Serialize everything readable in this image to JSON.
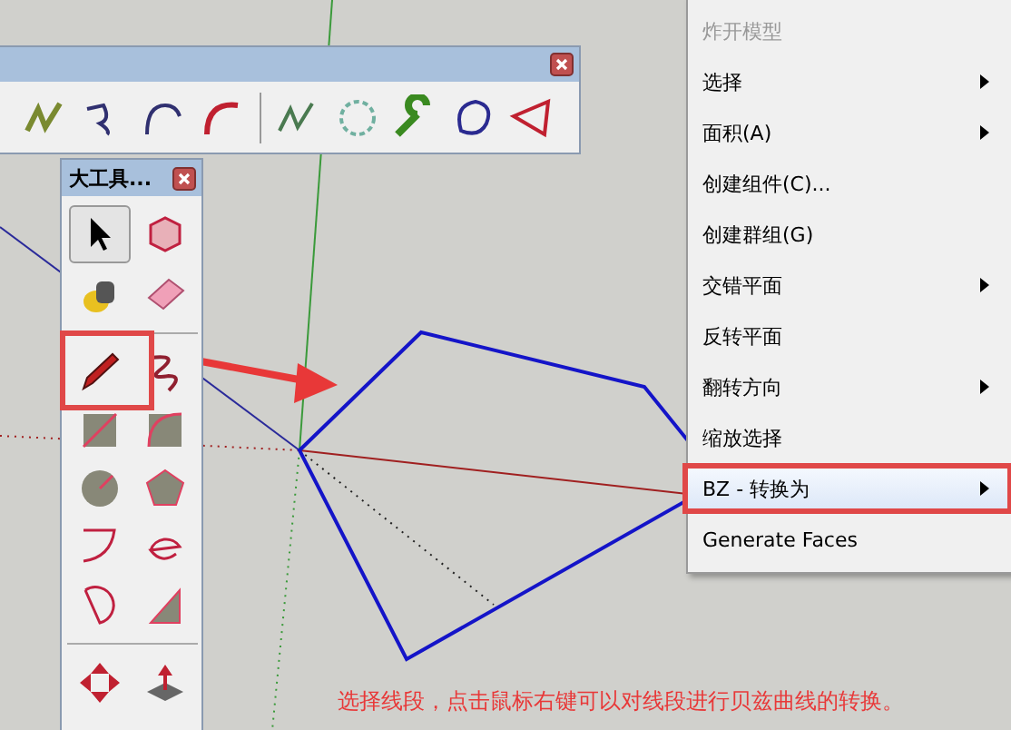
{
  "palette": {
    "title": "大工具..."
  },
  "context_menu": {
    "items": [
      {
        "label": "炸开模型",
        "disabled": true,
        "submenu": false,
        "selected": false
      },
      {
        "label": "选择",
        "disabled": false,
        "submenu": true,
        "selected": false
      },
      {
        "label": "面积(A)",
        "disabled": false,
        "submenu": true,
        "selected": false
      },
      {
        "label": "创建组件(C)...",
        "disabled": false,
        "submenu": false,
        "selected": false
      },
      {
        "label": "创建群组(G)",
        "disabled": false,
        "submenu": false,
        "selected": false
      },
      {
        "label": "交错平面",
        "disabled": false,
        "submenu": true,
        "selected": false
      },
      {
        "label": "反转平面",
        "disabled": false,
        "submenu": false,
        "selected": false
      },
      {
        "label": "翻转方向",
        "disabled": false,
        "submenu": true,
        "selected": false
      },
      {
        "label": "缩放选择",
        "disabled": false,
        "submenu": false,
        "selected": false
      },
      {
        "label": "BZ - 转换为",
        "disabled": false,
        "submenu": true,
        "selected": true
      },
      {
        "label": "Generate Faces",
        "disabled": false,
        "submenu": false,
        "selected": false
      }
    ]
  },
  "caption": "选择线段，点击鼠标右键可以对线段进行贝兹曲线的转换。"
}
